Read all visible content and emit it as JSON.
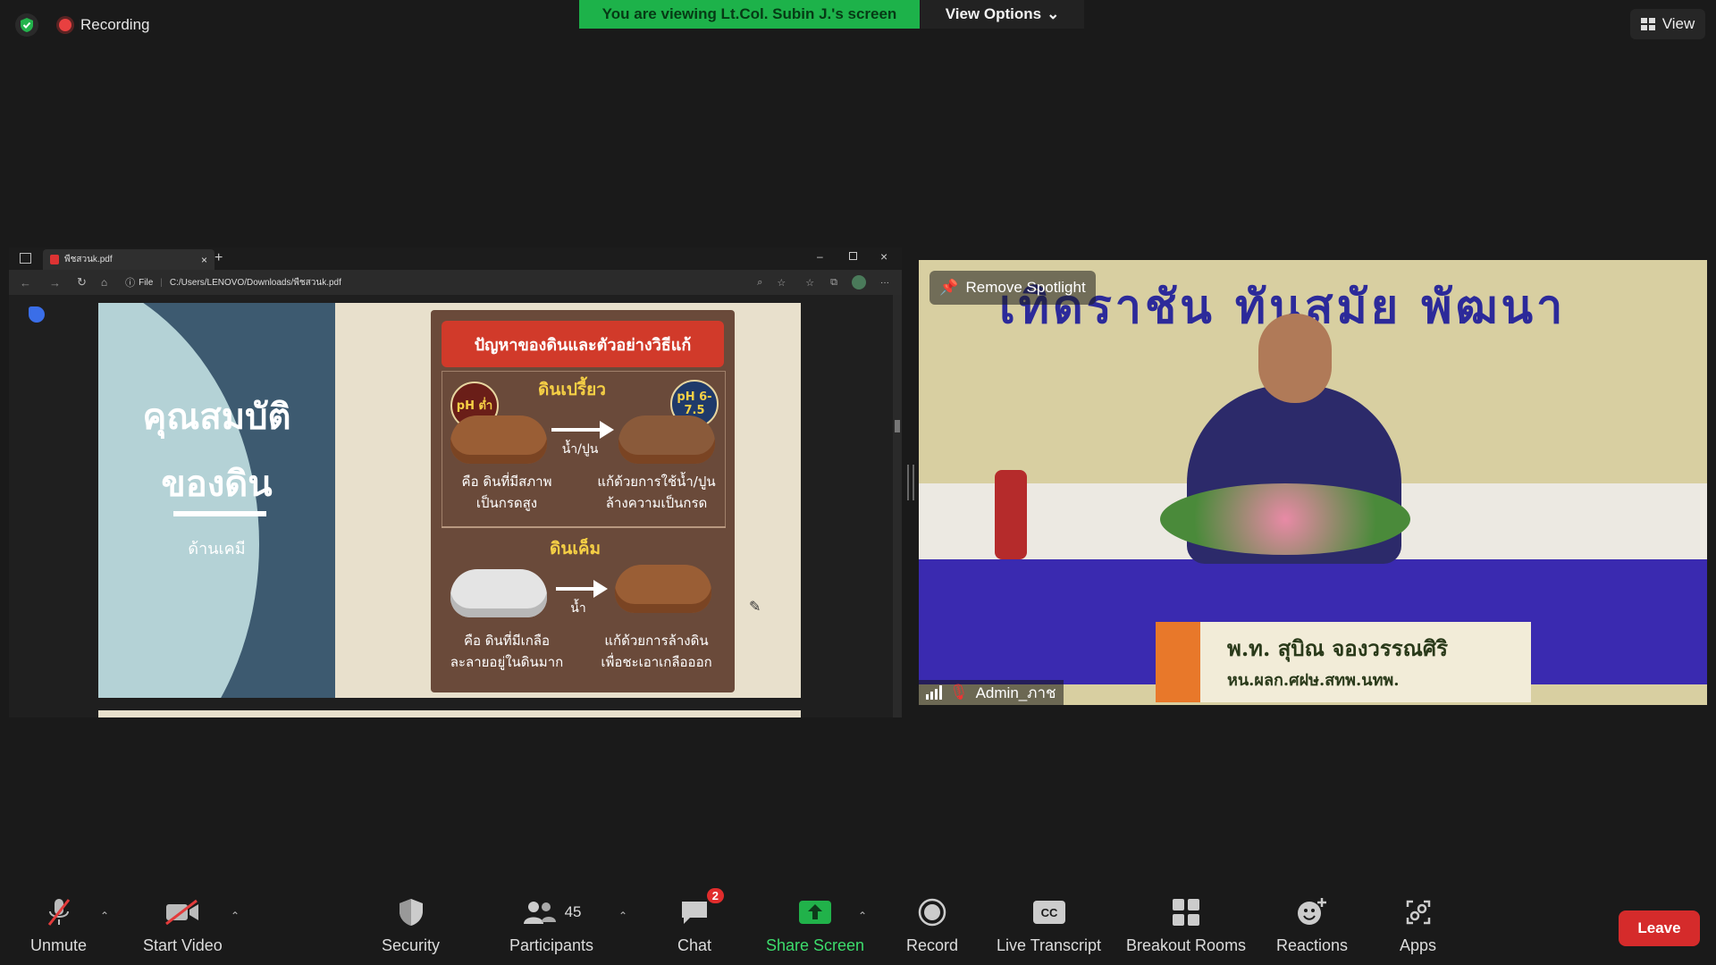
{
  "status": {
    "recording_label": "Recording"
  },
  "banner": {
    "viewing_text": "You are viewing Lt.Col. Subin J.'s screen",
    "view_options_label": "View Options"
  },
  "view_button": {
    "label": "View"
  },
  "browser": {
    "tab_title": "พืชสวนk.pdf",
    "url_scheme": "File",
    "url": "C:/Users/LENOVO/Downloads/พืชสวนk.pdf"
  },
  "slide": {
    "title_line1": "คุณสมบัติ",
    "title_line2": "ของดิน",
    "subtitle": "ด้านเคมี",
    "card_title": "ปัญหาของดินและตัวอย่างวิธีแก้",
    "section1_title": "ดินเปรี้ยว",
    "section1_badge_left": "pH ต่ำ",
    "section1_badge_right": "pH 6-7.5",
    "section1_arrow_label": "น้ำ/ปูน",
    "section1_left_text_1": "คือ ดินที่มีสภาพ",
    "section1_left_text_2": "เป็นกรดสูง",
    "section1_right_text_1": "แก้ด้วยการใช้น้ำ/ปูน",
    "section1_right_text_2": "ล้างความเป็นกรด",
    "section2_title": "ดินเค็ม",
    "section2_arrow_label": "น้ำ",
    "section2_left_text_1": "คือ ดินที่มีเกลือ",
    "section2_left_text_2": "ละลายอยู่ในดินมาก",
    "section2_right_text_1": "แก้ด้วยการล้างดิน",
    "section2_right_text_2": "เพื่อชะเอาเกลือออก"
  },
  "video": {
    "remove_spotlight_label": "Remove Spotlight",
    "participant_name": "Admin_ภาช",
    "backdrop_text": "เทิดราชัน    ทันสมัย    พัฒนา",
    "nameplate_line1": "พ.ท. สุบิณ  จองวรรณศิริ",
    "nameplate_line2": "หน.ผลก.ศฝษ.สทพ.นทพ."
  },
  "toolbar": {
    "unmute": "Unmute",
    "start_video": "Start Video",
    "security": "Security",
    "participants": "Participants",
    "participants_count": "45",
    "chat": "Chat",
    "chat_badge": "2",
    "share_screen": "Share Screen",
    "record": "Record",
    "live_transcript": "Live Transcript",
    "breakout_rooms": "Breakout Rooms",
    "reactions": "Reactions",
    "apps": "Apps",
    "leave": "Leave"
  },
  "colors": {
    "accent_green": "#1db24a",
    "leave_red": "#d52b2b",
    "badge_red": "#e02c2c"
  }
}
